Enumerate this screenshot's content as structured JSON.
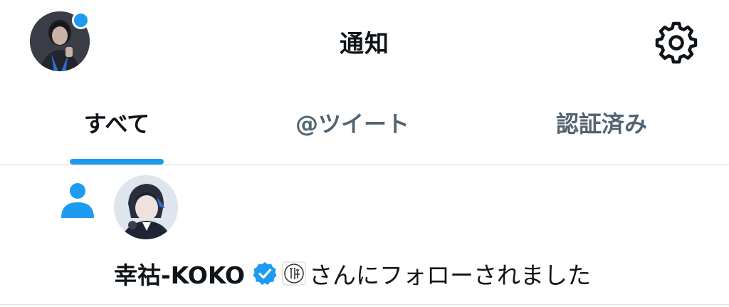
{
  "header": {
    "title": "通知",
    "avatar_icon": "profile-avatar",
    "settings_icon": "gear-icon",
    "accent_color": "#1d9bf0"
  },
  "tabs": [
    {
      "label": "すべて",
      "active": true
    },
    {
      "label": "@ツイート",
      "active": false
    },
    {
      "label": "認証済み",
      "active": false
    }
  ],
  "notification": {
    "icon": "person-icon",
    "username": "幸祜-KOKO",
    "verified": true,
    "stamp_text": "神椿",
    "action_text": "さんにフォローされました"
  }
}
